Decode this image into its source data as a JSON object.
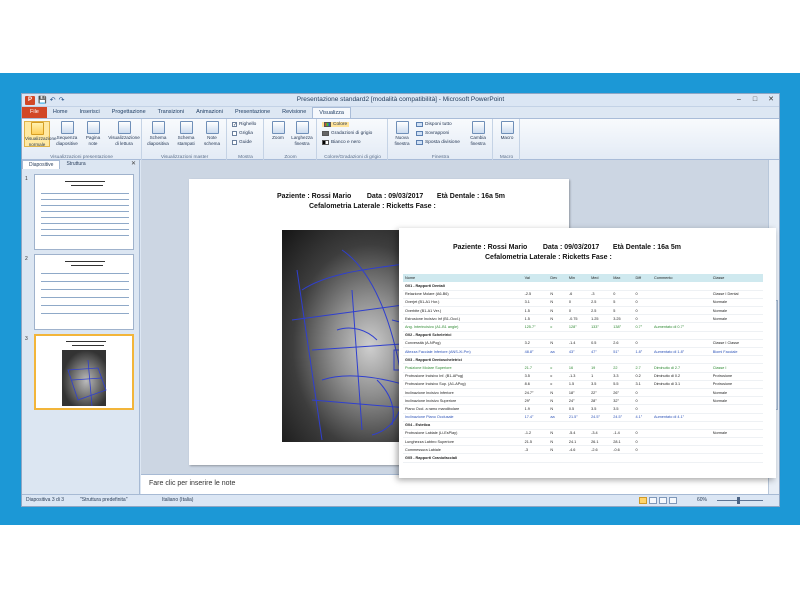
{
  "titlebar": {
    "title": "Presentazione standard2 [modalità compatibilità] - Microsoft PowerPoint",
    "app_icon": "P",
    "qat_save": "💾",
    "qat_undo": "↶",
    "qat_redo": "↷",
    "min": "–",
    "max": "□",
    "close": "✕"
  },
  "tabs": [
    "File",
    "Home",
    "Inserisci",
    "Progettazione",
    "Transizioni",
    "Animazioni",
    "Presentazione",
    "Revisione",
    "Visualizza"
  ],
  "ribbon": {
    "group_views": {
      "label": "Visualizzazioni presentazione",
      "buttons": [
        "Visualizzazione normale",
        "Sequenza diapositive",
        "Pagina note",
        "Visualizzazione di lettura"
      ]
    },
    "group_master": {
      "label": "Visualizzazioni master",
      "buttons": [
        "Schema diapositiva",
        "Schema stampati",
        "Note schema"
      ]
    },
    "group_show": {
      "label": "Mostra",
      "items": [
        "Righello",
        "Griglia",
        "Guide"
      ]
    },
    "group_zoom": {
      "label": "Zoom",
      "buttons": [
        "Zoom",
        "Larghezza finestra"
      ]
    },
    "group_color": {
      "label": "Colore/Gradazioni di grigio",
      "items": [
        "Colore",
        "Gradazioni di grigio",
        "Bianco e nero"
      ]
    },
    "group_window": {
      "label": "Finestra",
      "new_window": "Nuova finestra",
      "items": [
        "Disponi tutto",
        "Sovrapponi",
        "Sposta divisione"
      ],
      "switch": "Cambia finestra"
    },
    "group_macro": {
      "label": "Macro",
      "button": "Macro"
    }
  },
  "panel": {
    "tab_slides": "Diapositive",
    "tab_outline": "Struttura",
    "close": "✕",
    "thumbs": [
      "1",
      "2",
      "3"
    ]
  },
  "report": {
    "patient": "Paziente : Rossi Mario",
    "date": "Data : 09/03/2017",
    "age": "Età Dentale : 16a 5m",
    "subtitle": "Cefalometria Laterale : Ricketts Fase :",
    "columns": [
      "Nome",
      "Val",
      "Dev",
      "Min",
      "Med",
      "Max",
      "Diff",
      "Commento",
      "Classe"
    ],
    "rows": [
      {
        "type": "sec",
        "cells": [
          "G01 - Rapporti Dentali"
        ]
      },
      {
        "type": "",
        "cells": [
          "Relazione Molare (A6-B6)",
          "-2.5",
          "N",
          "-6",
          "-3",
          "0",
          "0",
          "",
          "Classe I Dental"
        ]
      },
      {
        "type": "",
        "cells": [
          "Overjet (B1-A1 Hor.)",
          "3.1",
          "N",
          "0",
          "2.5",
          "5",
          "0",
          "",
          "Normale"
        ]
      },
      {
        "type": "",
        "cells": [
          "Overbite (B1-A1 Ver.)",
          "1.5",
          "N",
          "0",
          "2.5",
          "5",
          "0",
          "",
          "Normale"
        ]
      },
      {
        "type": "",
        "cells": [
          "Estrusione Incisivo Inf (B1-Occl.)",
          "1.5",
          "N",
          "-0.75",
          "1.25",
          "3.25",
          "0",
          "",
          "Normale"
        ]
      },
      {
        "type": "green",
        "cells": [
          "Ang. Interincisivo (A1-B1 angle)",
          "125.7°",
          "c",
          "128°",
          "133°",
          "138°",
          "0.7°",
          "Aumentato di 0.7°",
          ""
        ]
      },
      {
        "type": "sec",
        "cells": [
          "G02 - Rapporti Scheletrici"
        ]
      },
      {
        "type": "",
        "cells": [
          "Convessità (A-NPog)",
          "3.2",
          "N",
          "-1.4",
          "0.5",
          "2.6",
          "0",
          "",
          "Classe I Classe"
        ]
      },
      {
        "type": "blue",
        "cells": [
          "Altezza Facciale Inferiore (ANS-Xi-Pm)",
          "48.8°",
          "aa",
          "43°",
          "47°",
          "51°",
          "1.8°",
          "Aumentato di 1.8°",
          "Biomi Facciale"
        ]
      },
      {
        "type": "sec",
        "cells": [
          "G03 - Rapporti Dentoscheletrici"
        ]
      },
      {
        "type": "green",
        "cells": [
          "Posizione Molare Superiore",
          "21.7",
          "c",
          "16",
          "19",
          "22",
          "2.7",
          "Diminuito di 2.7",
          "Classe I"
        ]
      },
      {
        "type": "",
        "cells": [
          "Protrusione Incisivo Inf. (B1-APog)",
          "3.5",
          "c",
          "-1.3",
          "1",
          "3.3",
          "0.2",
          "Diminuito di 0.2",
          "Protrusione"
        ]
      },
      {
        "type": "",
        "cells": [
          "Protrusione Incisivo Sup. (A1-APog)",
          "8.6",
          "c",
          "1.5",
          "3.5",
          "5.5",
          "3.1",
          "Diminuito di 3.1",
          "Protrusione"
        ]
      },
      {
        "type": "",
        "cells": [
          "Inclinazione Incisivo Inferiore",
          "24.7°",
          "N",
          "18°",
          "22°",
          "26°",
          "0",
          "",
          "Normale"
        ]
      },
      {
        "type": "",
        "cells": [
          "Inclinazione Incisivo Superiore",
          "29°",
          "N",
          "24°",
          "28°",
          "32°",
          "0",
          "",
          "Normale"
        ]
      },
      {
        "type": "",
        "cells": [
          "Piano Occl. a ramo mandibolare",
          "1.9",
          "N",
          "0.5",
          "3.5",
          "3.5",
          "0",
          "",
          ""
        ]
      },
      {
        "type": "blue",
        "cells": [
          "Inclinazione Piano Occlusale",
          "17.4°",
          "aa",
          "21.5°",
          "24.5°",
          "24.5°",
          "4.1°",
          "Aumentato di 4.1°",
          ""
        ]
      },
      {
        "type": "sec",
        "cells": [
          "G04 - Estetica"
        ]
      },
      {
        "type": "",
        "cells": [
          "Protrusione Labiale (Li-EsPlay)",
          "-1.2",
          "N",
          "-5.4",
          "-3.4",
          "-1.4",
          "0",
          "",
          "Normale"
        ]
      },
      {
        "type": "",
        "cells": [
          "Lunghezza Labbro Superiore",
          "21.5",
          "N",
          "24.1",
          "26.1",
          "28.1",
          "0",
          "",
          ""
        ]
      },
      {
        "type": "",
        "cells": [
          "Commessura Labiale",
          "-3",
          "N",
          "-4.6",
          "-2.6",
          "-0.6",
          "0",
          "",
          ""
        ]
      },
      {
        "type": "sec",
        "cells": [
          "G05 - Rapporti Craniofacciali"
        ]
      }
    ]
  },
  "notes": {
    "placeholder": "Fare clic per inserire le note"
  },
  "status": {
    "slide": "Diapositiva 3 di 3",
    "theme": "\"Struttura predefinita\"",
    "language": "Italiano (Italia)",
    "zoom": "60%"
  },
  "colors": {
    "frame": "#1c98d6",
    "file_tab": "#d24726",
    "table_header": "#cfe9ef",
    "trace": "#2f3fcf"
  }
}
